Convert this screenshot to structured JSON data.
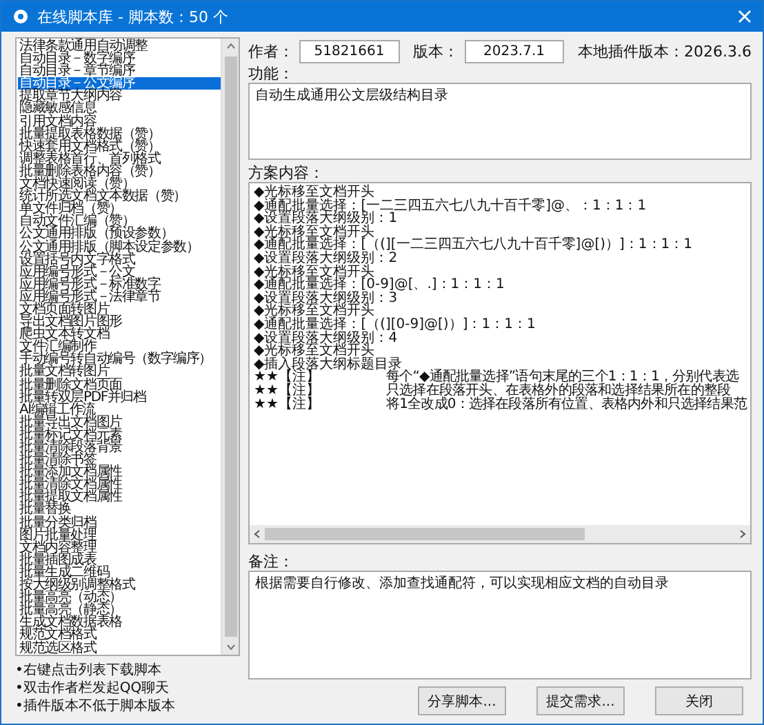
{
  "window": {
    "title": "在线脚本库 - 脚本数：50 个"
  },
  "script_list": {
    "items": [
      {
        "label": "法律条款通用自动调整",
        "selected": false
      },
      {
        "label": "自动目录－数字编序",
        "selected": false
      },
      {
        "label": "自动目录－章节编序",
        "selected": false
      },
      {
        "label": "自动目录－公文编序",
        "selected": true
      },
      {
        "label": "提取章节大纲内容",
        "selected": false
      },
      {
        "label": "隐藏敏感信息",
        "selected": false
      },
      {
        "label": "引用文档内容",
        "selected": false
      },
      {
        "label": "批量提取表格数据（赞）",
        "selected": false
      },
      {
        "label": "快速套用文档格式（赞）",
        "selected": false
      },
      {
        "label": "调整表格首行、首列格式",
        "selected": false
      },
      {
        "label": "批量删除表格内容（赞）",
        "selected": false
      },
      {
        "label": "文档快速阅读（赞）",
        "selected": false
      },
      {
        "label": "统计所选文档文本数据（赞）",
        "selected": false
      },
      {
        "label": "单文件归档（赞）",
        "selected": false
      },
      {
        "label": "自动文件汇编（赞）",
        "selected": false
      },
      {
        "label": "公文通用排版（预设参数）",
        "selected": false
      },
      {
        "label": "公文通用排版（脚本设定参数）",
        "selected": false
      },
      {
        "label": "设置括号内文字格式",
        "selected": false
      },
      {
        "label": "应用编号形式－公文",
        "selected": false
      },
      {
        "label": "应用编号形式－标准数字",
        "selected": false
      },
      {
        "label": "应用编号形式－法律章节",
        "selected": false
      },
      {
        "label": "文档页面转图片",
        "selected": false
      },
      {
        "label": "导出文档图片图形",
        "selected": false
      },
      {
        "label": "爬虫文本转文档",
        "selected": false
      },
      {
        "label": "文件汇编制作",
        "selected": false
      },
      {
        "label": "手动编号转自动编号（数字编序）",
        "selected": false
      },
      {
        "label": "批量文档转图片",
        "selected": false
      },
      {
        "label": "批量删除文档页面",
        "selected": false
      },
      {
        "label": "批量转双层PDF并归档",
        "selected": false
      },
      {
        "label": "AI编辑工作流",
        "selected": false
      },
      {
        "label": "批量导出文档图片",
        "selected": false
      },
      {
        "label": "批量标记文档元素",
        "selected": false
      },
      {
        "label": "批量清除段落背景",
        "selected": false
      },
      {
        "label": "批量清除书签",
        "selected": false
      },
      {
        "label": "批量添加文档属性",
        "selected": false
      },
      {
        "label": "批量清除文档属性",
        "selected": false
      },
      {
        "label": "批量提取文档属性",
        "selected": false
      },
      {
        "label": "批量替换",
        "selected": false
      },
      {
        "label": "批量分类归档",
        "selected": false
      },
      {
        "label": "图片批量处理",
        "selected": false
      },
      {
        "label": "文档内容整理",
        "selected": false
      },
      {
        "label": "批量插图成表",
        "selected": false
      },
      {
        "label": "批量生成二维码",
        "selected": false
      },
      {
        "label": "按大纲级别调整格式",
        "selected": false
      },
      {
        "label": "批量高亮（动态）",
        "selected": false
      },
      {
        "label": "批量高亮（静态）",
        "selected": false
      },
      {
        "label": "生成文档数据表格",
        "selected": false
      },
      {
        "label": "规范文档格式",
        "selected": false
      },
      {
        "label": "规范选区格式",
        "selected": false
      }
    ]
  },
  "hints": [
    "•右键点击列表下载脚本",
    "•双击作者栏发起QQ聊天",
    "•插件版本不低于脚本版本"
  ],
  "info": {
    "author_label": "作者：",
    "author": "51821661",
    "version_label": "版本：",
    "version": "2023.7.1",
    "local_version": "本地插件版本：2026.3.6"
  },
  "function": {
    "label": "功能：",
    "value": "自动生成通用公文层级结构目录"
  },
  "script": {
    "label": "方案内容：",
    "lines": [
      {
        "kind": "step",
        "text": "◆光标移至文档开头"
      },
      {
        "kind": "step",
        "text": "◆通配批量选择：[一二三四五六七八九十百千零]@、：1：1：1"
      },
      {
        "kind": "step",
        "text": "◆设置段落大纲级别：1"
      },
      {
        "kind": "step",
        "text": "◆光标移至文档开头"
      },
      {
        "kind": "step",
        "text": "◆通配批量选择：[（(][一二三四五六七八九十百千零]@[)）]：1：1：1"
      },
      {
        "kind": "step",
        "text": "◆设置段落大纲级别：2"
      },
      {
        "kind": "step",
        "text": "◆光标移至文档开头"
      },
      {
        "kind": "step",
        "text": "◆通配批量选择：[0-9]@[、.]：1：1：1"
      },
      {
        "kind": "step",
        "text": "◆设置段落大纲级别：3"
      },
      {
        "kind": "step",
        "text": "◆光标移至文档开头"
      },
      {
        "kind": "step",
        "text": "◆通配批量选择：[（(][0-9]@[)）]：1：1：1"
      },
      {
        "kind": "step",
        "text": "◆设置段落大纲级别：4"
      },
      {
        "kind": "step",
        "text": "◆光标移至文档开头"
      },
      {
        "kind": "step",
        "text": "◆插入段落大纲标题目录"
      },
      {
        "kind": "note",
        "mark": "★★【注】",
        "text": "每个“◆通配批量选择”语句末尾的三个1：1：1，分别代表选"
      },
      {
        "kind": "note",
        "mark": "★★【注】",
        "text": "只选择在段落开头、在表格外的段落和选择结果所在的整段"
      },
      {
        "kind": "note",
        "mark": "★★【注】",
        "text": "将1全改成0：选择在段落所有位置、表格内外和只选择结果范"
      }
    ]
  },
  "remarks": {
    "label": "备注：",
    "value": "根据需要自行修改、添加查找通配符，可以实现相应文档的自动目录"
  },
  "buttons": [
    "分享脚本...",
    "提交需求...",
    "关闭"
  ]
}
